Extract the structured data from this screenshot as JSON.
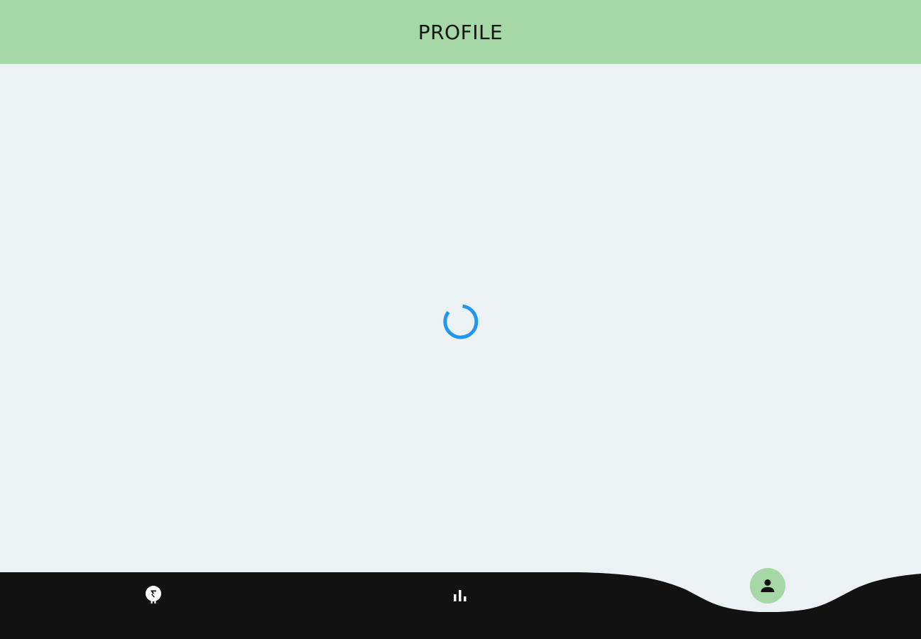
{
  "app_bar": {
    "title": "PROFILE",
    "background_color": "#a5d7a7"
  },
  "content": {
    "background_color": "#ecf1f4",
    "loading_indicator": {
      "icon": "loading-spinner",
      "color": "#2196f3"
    }
  },
  "bottom_nav": {
    "background_color": "#121212",
    "items": [
      {
        "icon": "coin-pin-icon",
        "selected": false
      },
      {
        "icon": "bar-chart-icon",
        "selected": false
      },
      {
        "icon": "person-icon",
        "selected": true,
        "highlight_color": "#a5d7a7"
      }
    ]
  }
}
